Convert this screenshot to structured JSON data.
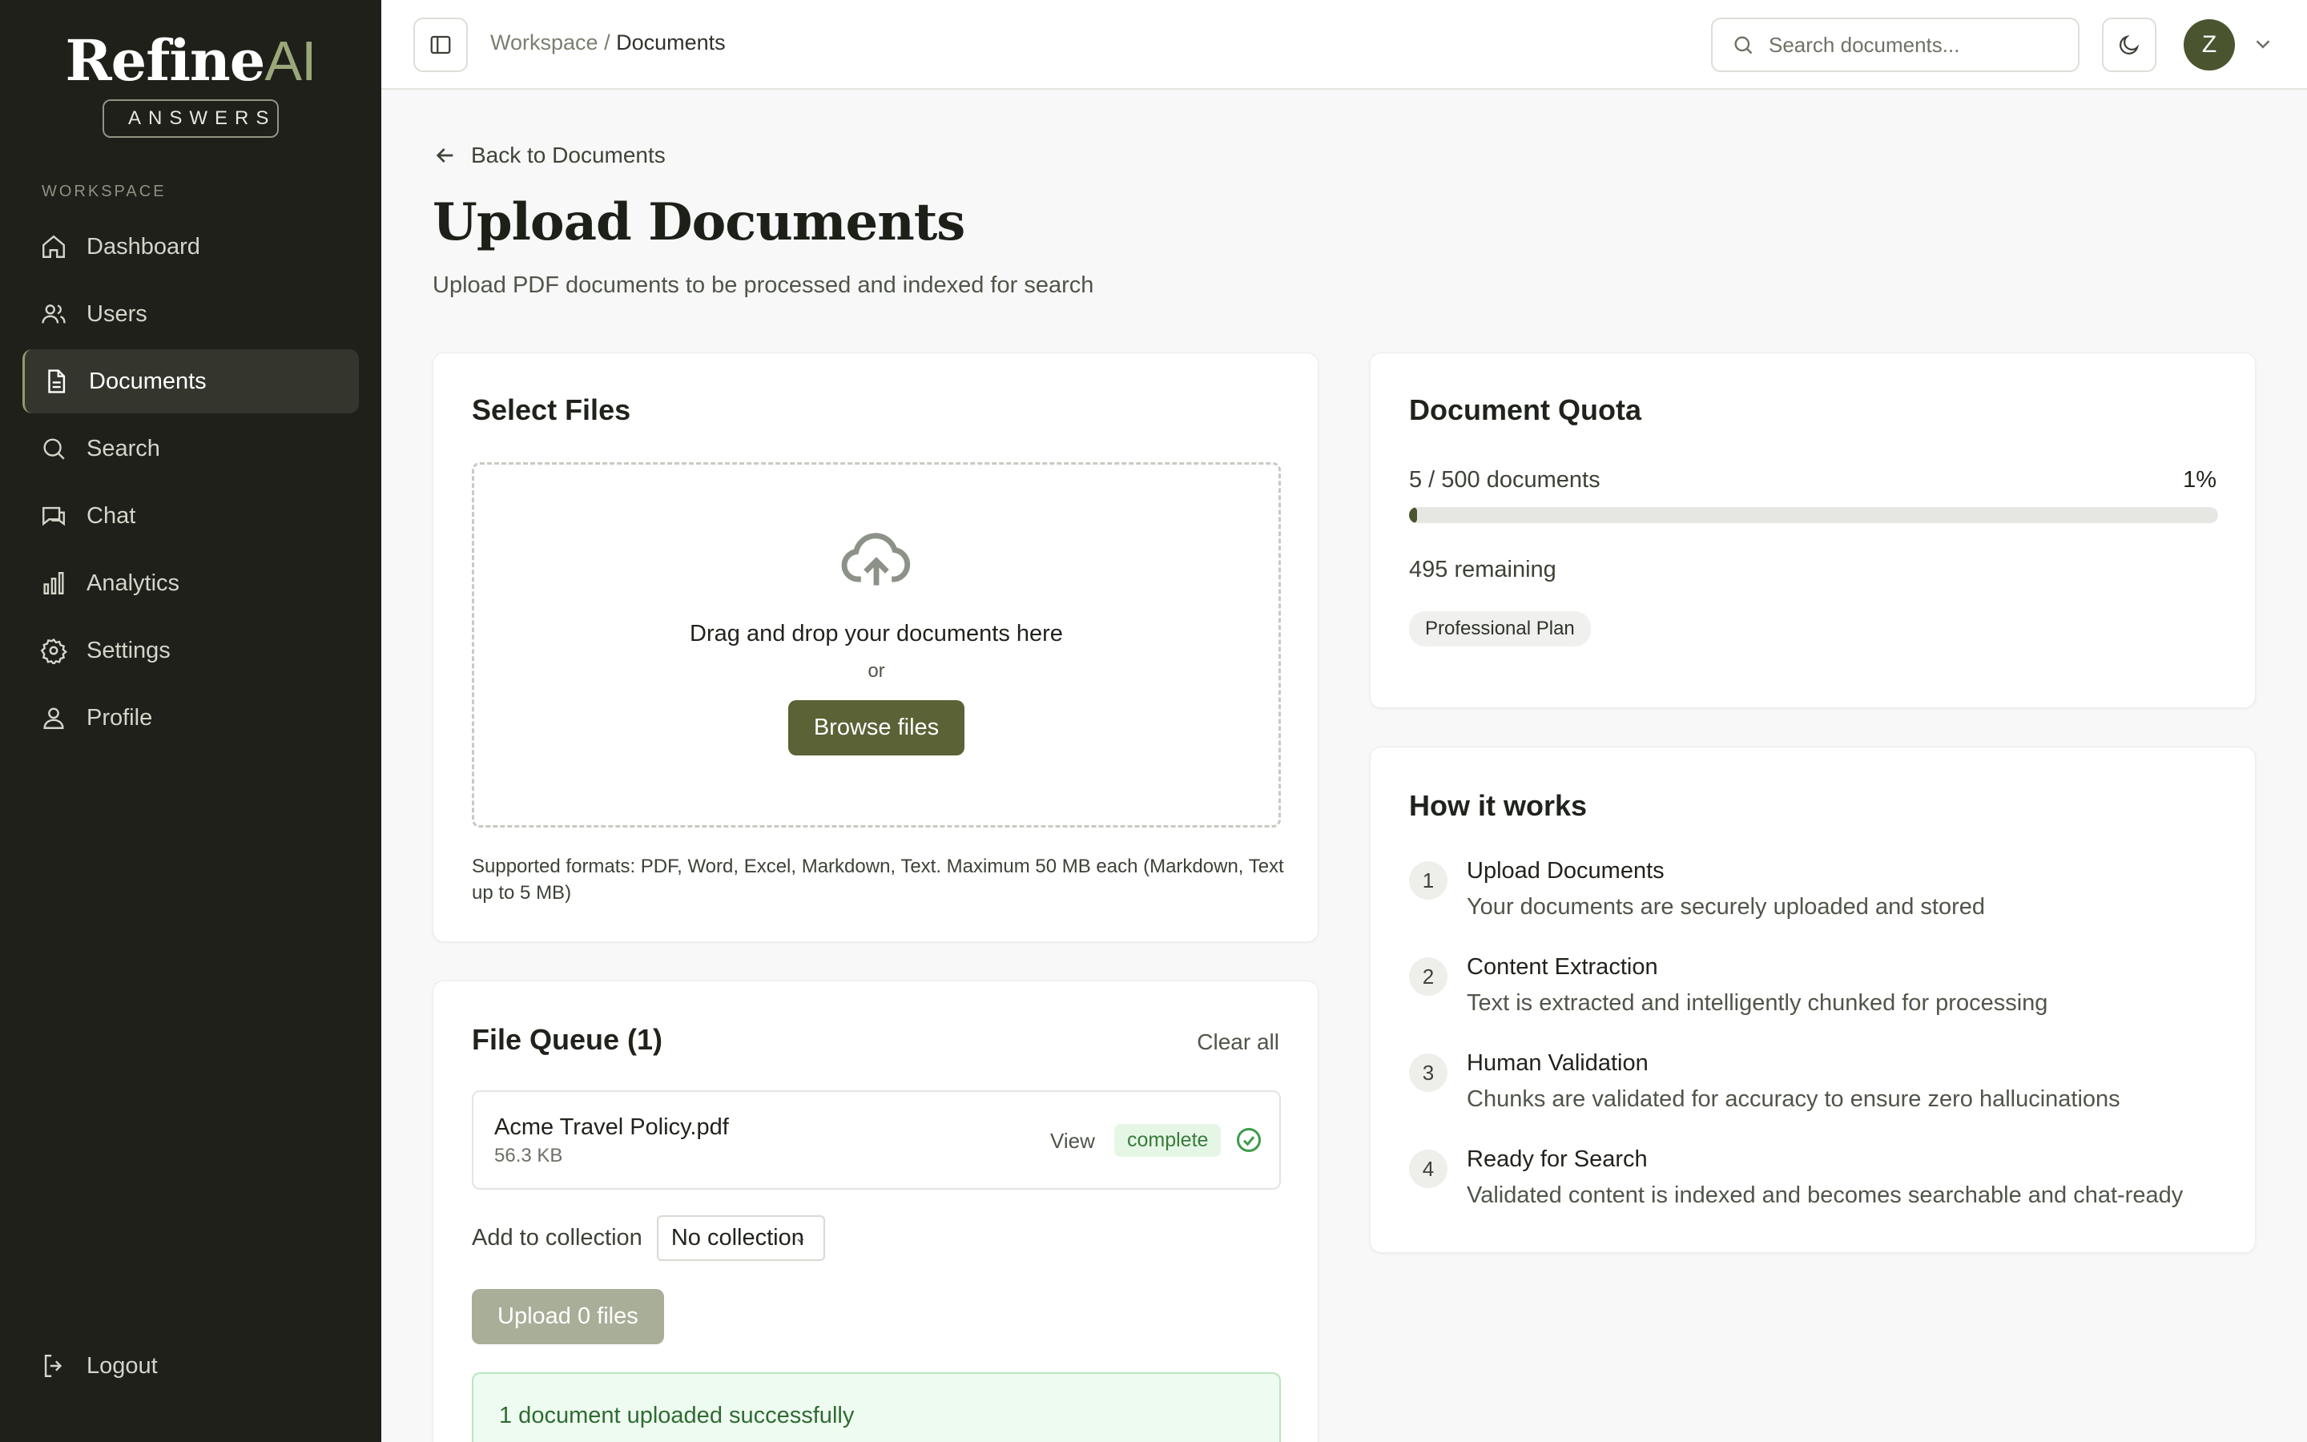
{
  "brand": {
    "name_main": "Refine",
    "name_accent": "AI",
    "badge": "ANSWERS"
  },
  "sidebar": {
    "section_label": "WORKSPACE",
    "items": [
      {
        "label": "Dashboard",
        "icon": "home-icon"
      },
      {
        "label": "Users",
        "icon": "users-icon"
      },
      {
        "label": "Documents",
        "icon": "document-icon",
        "active": true
      },
      {
        "label": "Search",
        "icon": "search-icon"
      },
      {
        "label": "Chat",
        "icon": "chat-icon"
      },
      {
        "label": "Analytics",
        "icon": "bar-chart-icon"
      },
      {
        "label": "Settings",
        "icon": "gear-icon"
      },
      {
        "label": "Profile",
        "icon": "user-icon"
      }
    ],
    "logout": "Logout"
  },
  "topbar": {
    "breadcrumb_root": "Workspace",
    "breadcrumb_sep": "/",
    "breadcrumb_current": "Documents",
    "search_placeholder": "Search documents...",
    "avatar_initial": "Z"
  },
  "page": {
    "back_label": "Back to Documents",
    "title": "Upload Documents",
    "subtitle": "Upload PDF documents to be processed and indexed for search"
  },
  "select_files": {
    "title": "Select Files",
    "drop_text": "Drag and drop your documents here",
    "or_text": "or",
    "browse_label": "Browse files",
    "formats_note": "Supported formats: PDF, Word, Excel, Markdown, Text. Maximum 50 MB each (Markdown, Text up to 5 MB)"
  },
  "queue": {
    "title": "File Queue (1)",
    "clear_label": "Clear all",
    "files": [
      {
        "name": "Acme Travel Policy.pdf",
        "size": "56.3 KB",
        "view_label": "View",
        "status": "complete"
      }
    ],
    "collection_label": "Add to collection",
    "collection_value": "No collection",
    "upload_label": "Upload 0 files",
    "success_message": "1 document uploaded successfully"
  },
  "quota": {
    "title": "Document Quota",
    "count_text": "5 / 500 documents",
    "percent_text": "1%",
    "used_fraction": 0.01,
    "remaining_text": "495 remaining",
    "plan": "Professional Plan"
  },
  "how_it_works": {
    "title": "How it works",
    "steps": [
      {
        "num": "1",
        "title": "Upload Documents",
        "desc": "Your documents are securely uploaded and stored"
      },
      {
        "num": "2",
        "title": "Content Extraction",
        "desc": "Text is extracted and intelligently chunked for processing"
      },
      {
        "num": "3",
        "title": "Human Validation",
        "desc": "Chunks are validated for accuracy to ensure zero hallucinations"
      },
      {
        "num": "4",
        "title": "Ready for Search",
        "desc": "Validated content is indexed and becomes searchable and chat-ready"
      }
    ]
  },
  "colors": {
    "sidebar_bg": "#1f201a",
    "accent": "#5a6236",
    "logo_accent": "#9aa77a",
    "status_complete": "#3a7a3c"
  }
}
